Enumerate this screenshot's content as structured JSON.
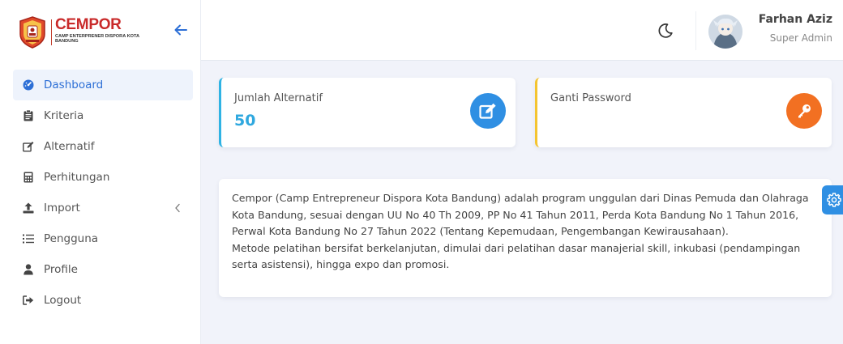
{
  "brand": {
    "title": "CEMPOR",
    "subtitle": "CAMP ENTERPRENER DISPORA KOTA BANDUNG"
  },
  "sidebar": {
    "items": [
      {
        "label": "Dashboard",
        "icon": "dashboard-icon",
        "active": true
      },
      {
        "label": "Kriteria",
        "icon": "clipboard-icon"
      },
      {
        "label": "Alternatif",
        "icon": "edit-icon"
      },
      {
        "label": "Perhitungan",
        "icon": "calculator-icon"
      },
      {
        "label": "Import",
        "icon": "upload-icon",
        "has_submenu": true
      },
      {
        "label": "Pengguna",
        "icon": "list-icon"
      },
      {
        "label": "Profile",
        "icon": "user-icon"
      },
      {
        "label": "Logout",
        "icon": "sign-out-icon"
      }
    ]
  },
  "user": {
    "name": "Farhan Aziz",
    "role": "Super Admin"
  },
  "cards": {
    "alternatif": {
      "label": "Jumlah Alternatif",
      "value": "50",
      "accent": "#2fb3e4"
    },
    "password": {
      "label": "Ganti Password",
      "accent": "#f4c430"
    }
  },
  "description": {
    "text": "Cempor (Camp Entrepreneur Dispora Kota Bandung) adalah program unggulan dari Dinas Pemuda dan Olahraga Kota Bandung, sesuai dengan UU No 40 Th 2009, PP No 41 Tahun 2011, Perda Kota Bandung No 1 Tahun 2016, Perwal Kota Bandung No 27 Tahun 2022 (Tentang Kepemudaan, Pengembangan Kewirausahaan).",
    "text2": "Metode pelatihan bersifat berkelanjutan, dimulai dari pelatihan dasar manajerial skill, inkubasi (pendampingan serta asistensi), hingga expo dan promosi."
  },
  "colors": {
    "primary": "#2d6fd6",
    "brand_red": "#c92a2a",
    "orange": "#f27022"
  }
}
